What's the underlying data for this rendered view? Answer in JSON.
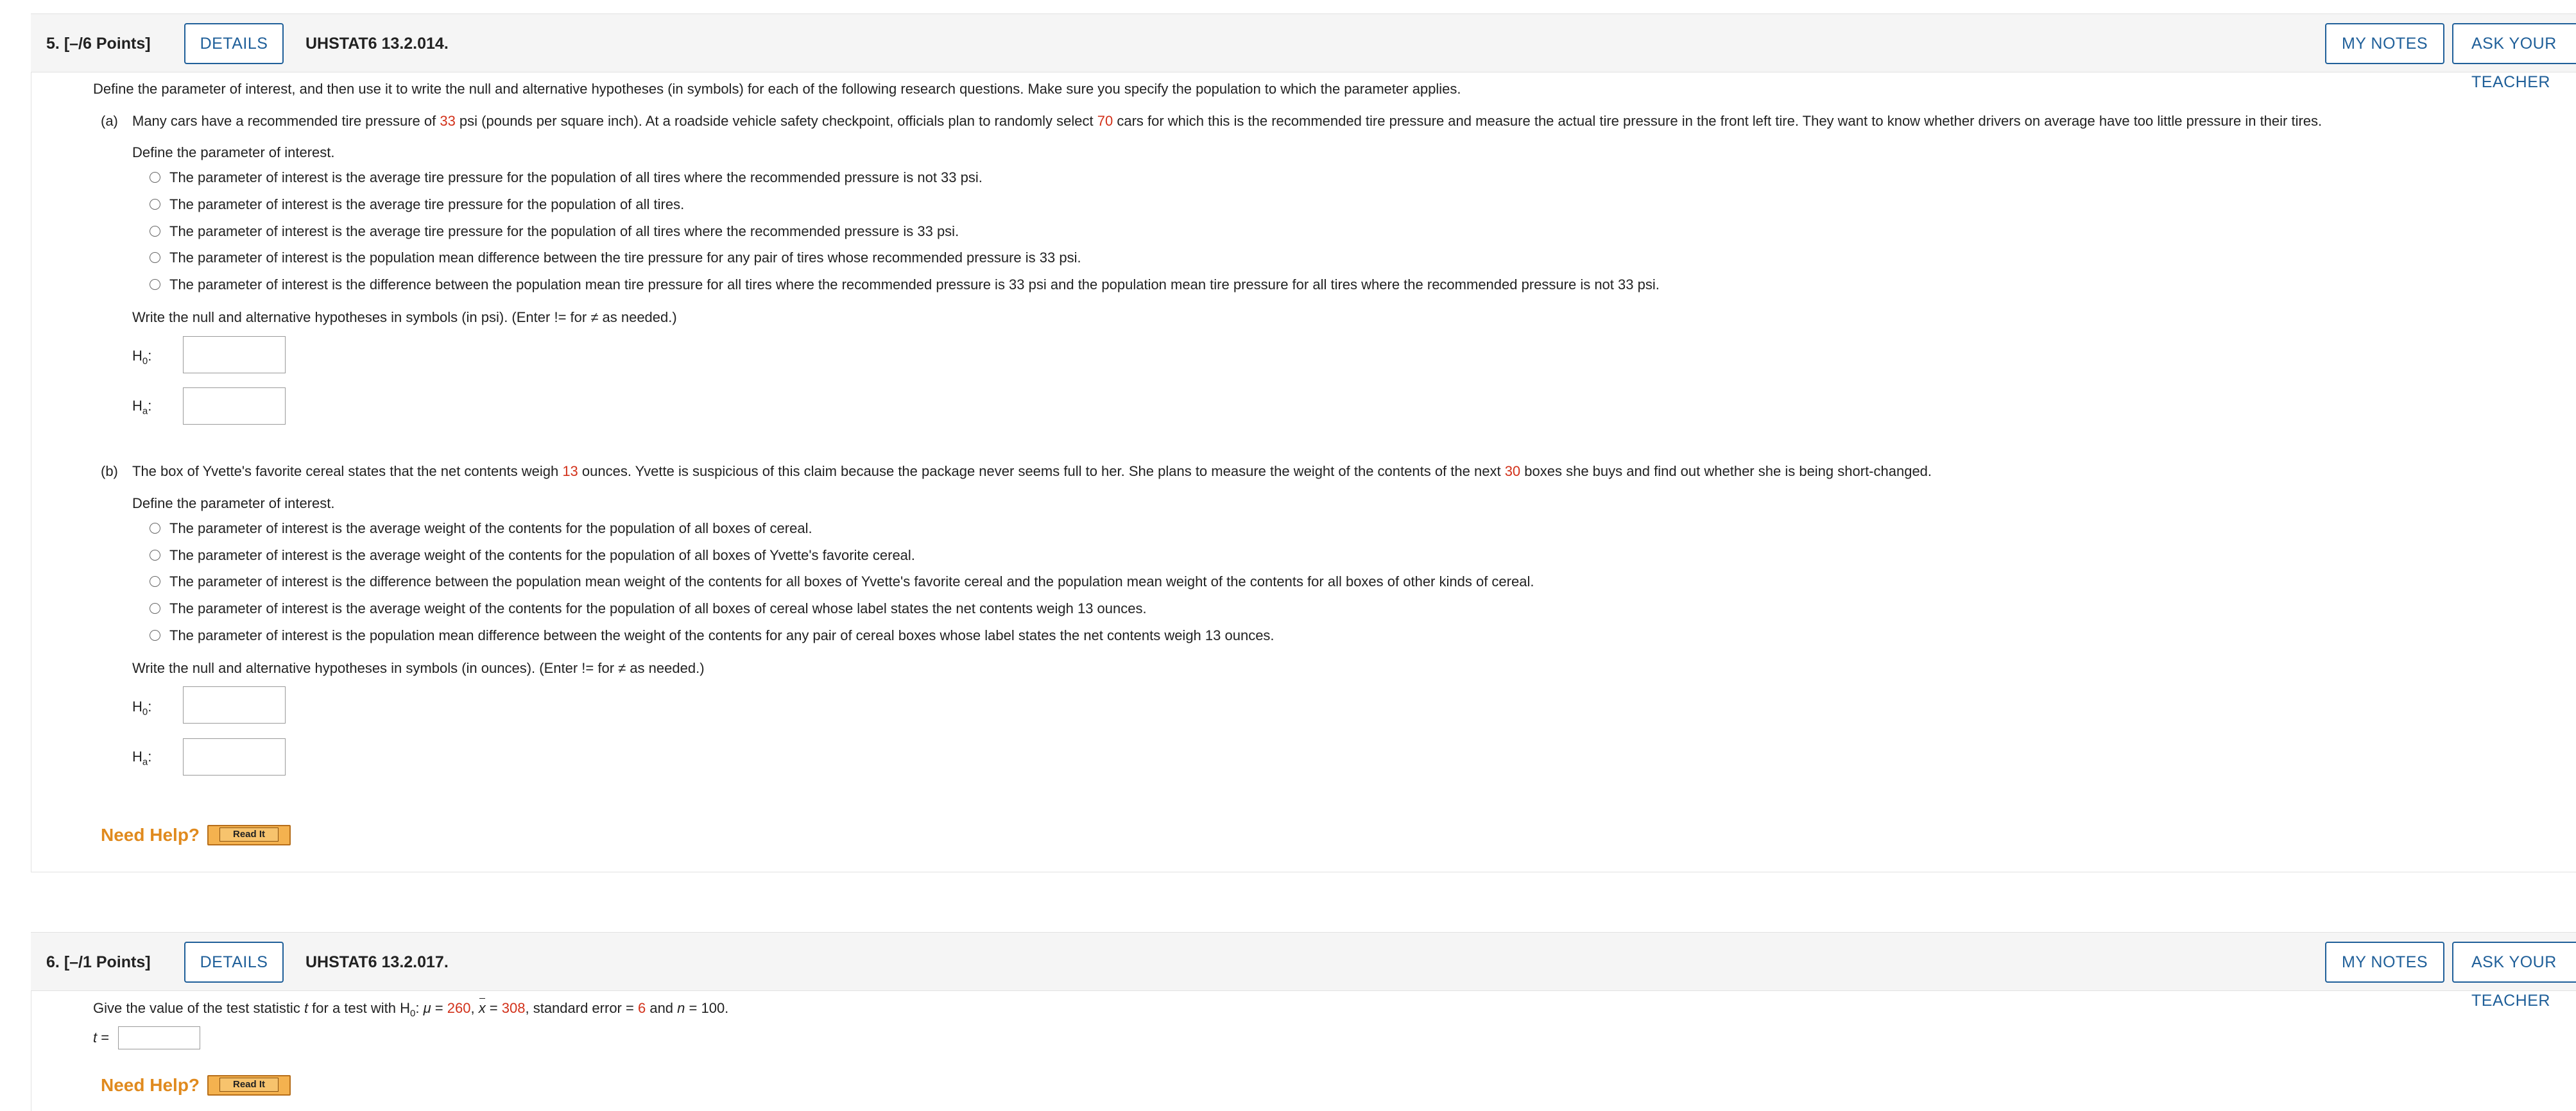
{
  "q5": {
    "header": {
      "number": "5.",
      "points": "[–/6 Points]",
      "details_label": "DETAILS",
      "id": "UHSTAT6 13.2.014.",
      "my_notes_label": "MY NOTES",
      "ask_teacher_label": "ASK YOUR TEACHER"
    },
    "intro": "Define the parameter of interest, and then use it to write the null and alternative hypotheses (in symbols) for each of the following research questions. Make sure you specify the population to which the parameter applies.",
    "part_a": {
      "letter": "(a)",
      "text_1": "Many cars have a recommended tire pressure of ",
      "value_1": "33",
      "text_2": " psi (pounds per square inch). At a roadside vehicle safety checkpoint, officials plan to randomly select ",
      "value_2": "70",
      "text_3": " cars for which this is the recommended tire pressure and measure the actual tire pressure in the front left tire. They want to know whether drivers on average have too little pressure in their tires.",
      "define_label": "Define the parameter of interest.",
      "options": [
        "The parameter of interest is the average tire pressure for the population of all tires where the recommended pressure is not 33 psi.",
        "The parameter of interest is the average tire pressure for the population of all tires.",
        "The parameter of interest is the average tire pressure for the population of all tires where the recommended pressure is 33 psi.",
        "The parameter of interest is the population mean difference between the tire pressure for any pair of tires whose recommended pressure is 33 psi.",
        "The parameter of interest is the difference between the population mean tire pressure for all tires where the recommended pressure is 33 psi and the population mean tire pressure for all tires where the recommended pressure is not 33 psi."
      ],
      "write_label": "Write the null and alternative hypotheses in symbols (in psi). (Enter != for ≠ as needed.)",
      "h0": "H",
      "h0_sub": "0",
      "ha": "H",
      "ha_sub": "a",
      "colon": ":"
    },
    "part_b": {
      "letter": "(b)",
      "text_1": "The box of Yvette's favorite cereal states that the net contents weigh ",
      "value_1": "13",
      "text_2": " ounces. Yvette is suspicious of this claim because the package never seems full to her. She plans to measure the weight of the contents of the next ",
      "value_2": "30",
      "text_3": " boxes she buys and find out whether she is being short-changed.",
      "define_label": "Define the parameter of interest.",
      "options": [
        "The parameter of interest is the average weight of the contents for the population of all boxes of cereal.",
        "The parameter of interest is the average weight of the contents for the population of all boxes of Yvette's favorite cereal.",
        "The parameter of interest is the difference between the population mean weight of the contents for all boxes of Yvette's favorite cereal and the population mean weight of the contents for all boxes of other kinds of cereal.",
        "The parameter of interest is the average weight of the contents for the population of all boxes of cereal whose label states the net contents weigh 13 ounces.",
        "The parameter of interest is the population mean difference between the weight of the contents for any pair of cereal boxes whose label states the net contents weigh 13 ounces."
      ],
      "write_label": "Write the null and alternative hypotheses in symbols (in ounces). (Enter != for ≠ as needed.)",
      "h0": "H",
      "h0_sub": "0",
      "ha": "H",
      "ha_sub": "a",
      "colon": ":"
    },
    "need_help": "Need Help?",
    "read_it": "Read It"
  },
  "q6": {
    "header": {
      "number": "6.",
      "points": "[–/1 Points]",
      "details_label": "DETAILS",
      "id": "UHSTAT6 13.2.017.",
      "my_notes_label": "MY NOTES",
      "ask_teacher_label": "ASK YOUR TEACHER"
    },
    "prompt_1": "Give the value of the test statistic ",
    "prompt_t": "t",
    "prompt_2": " for a test with H",
    "prompt_h_sub": "0",
    "prompt_3": ": ",
    "prompt_mu": "μ",
    "prompt_eq1": " = ",
    "mu_value": "260",
    "prompt_comma1": ", ",
    "prompt_x": "x",
    "prompt_eq2": " = ",
    "xbar_value": "308",
    "prompt_4": ", standard error = ",
    "se_value": "6",
    "prompt_5": " and ",
    "prompt_n": "n",
    "prompt_6": " = 100.",
    "t_label": "t",
    "t_eq": " =",
    "need_help": "Need Help?",
    "read_it": "Read It"
  },
  "colors": {
    "accent_blue": "#1f5f99",
    "value_red": "#d2311a",
    "need_help_orange": "#e08a1e",
    "read_it_button": "#f4b24f"
  }
}
